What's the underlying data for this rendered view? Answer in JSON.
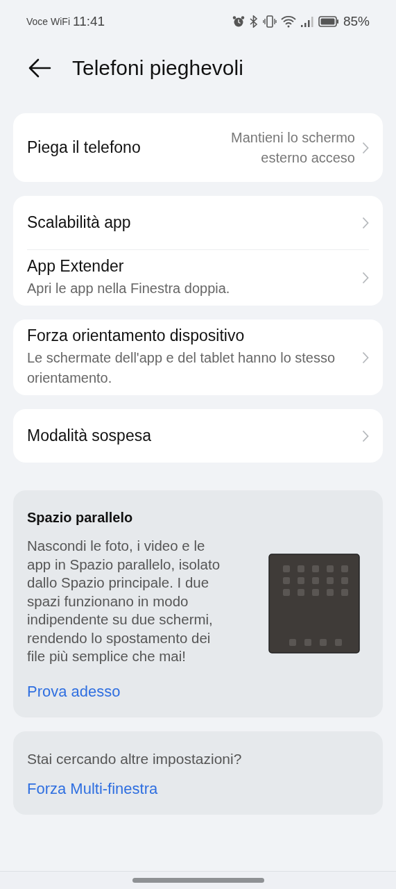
{
  "status_bar": {
    "carrier": "Voce WiFi",
    "time": "11:41",
    "battery": "85%"
  },
  "header": {
    "title": "Telefoni pieghevoli"
  },
  "groups": [
    {
      "items": [
        {
          "title": "Piega il telefono",
          "value": "Mantieni lo schermo esterno acceso"
        }
      ]
    },
    {
      "items": [
        {
          "title": "Scalabilità app"
        },
        {
          "title": "App Extender",
          "subtitle": "Apri le app nella Finestra doppia."
        }
      ]
    },
    {
      "items": [
        {
          "title": "Forza orientamento dispositivo",
          "subtitle": "Le schermate dell'app e del tablet hanno lo stesso orientamento."
        }
      ]
    },
    {
      "items": [
        {
          "title": "Modalità sospesa"
        }
      ]
    }
  ],
  "promo": {
    "title": "Spazio parallelo",
    "text": "Nascondi le foto, i video e le app in Spazio parallelo, isolato dallo Spazio principale. I due spazi funzionano in modo indipendente su due schermi, rendendo lo spostamento dei file più semplice che mai!",
    "link": "Prova adesso"
  },
  "more": {
    "question": "Stai cercando altre impostazioni?",
    "links": [
      "Forza Multi-finestra"
    ]
  }
}
